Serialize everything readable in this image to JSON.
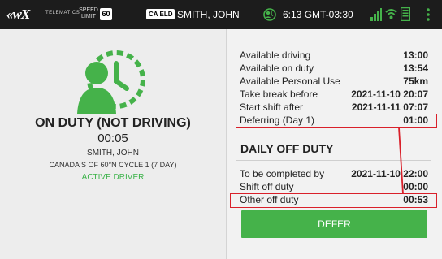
{
  "topbar": {
    "logo": "«wX",
    "logo_sub": "TELEMATICS",
    "speed_label_1": "SPEED",
    "speed_label_2": "LIMIT",
    "speed_value": "60",
    "eld_badge": "CA ELD",
    "driver_name": "SMITH, JOHN",
    "time": "6:13 GMT-03:30",
    "icons": [
      "status-icon",
      "signal-icon",
      "wifi-icon",
      "document-icon",
      "menu-icon"
    ]
  },
  "left": {
    "status": "ON DUTY (NOT DRIVING)",
    "elapsed": "00:05",
    "driver": "SMITH, JOHN",
    "cycle": "CANADA S OF 60°N CYCLE 1 (7 DAY)",
    "active": "ACTIVE DRIVER"
  },
  "availability": [
    {
      "label": "Available driving",
      "value": "13:00"
    },
    {
      "label": "Available on duty",
      "value": "13:54"
    },
    {
      "label": "Available Personal Use",
      "value": "75km"
    },
    {
      "label": "Take break before",
      "value": "2021-11-10 20:07"
    },
    {
      "label": "Start shift after",
      "value": "2021-11-11 07:07"
    },
    {
      "label": "Deferring (Day 1)",
      "value": "01:00"
    }
  ],
  "daily_off_duty": {
    "title": "DAILY OFF DUTY",
    "rows": [
      {
        "label": "To be completed by",
        "value": "2021-11-10 22:00"
      },
      {
        "label": "Shift off duty",
        "value": "00:00"
      },
      {
        "label": "Other off duty",
        "value": "00:53"
      }
    ]
  },
  "defer_button": "DEFER",
  "colors": {
    "accent_green": "#45b24a",
    "active_green": "#3cb34a",
    "highlight_red": "#d9202a",
    "topbar": "#1c1c1c"
  }
}
